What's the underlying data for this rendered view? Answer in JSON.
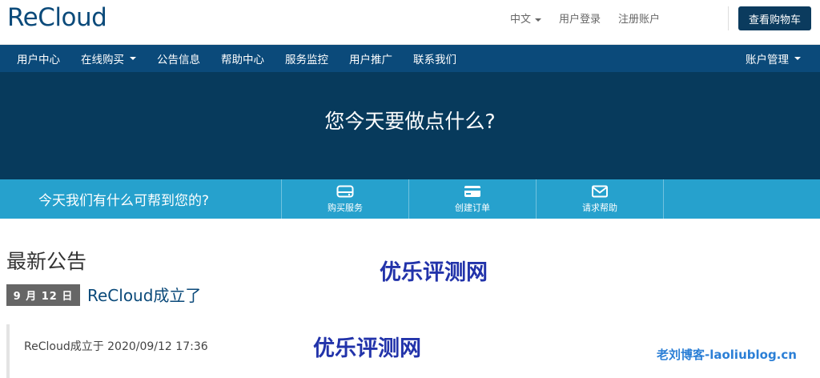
{
  "header": {
    "logo": "ReCloud",
    "language": "中文",
    "login": "用户登录",
    "register": "注册账户",
    "cart": "查看购物车"
  },
  "nav": {
    "items": [
      "用户中心",
      "在线购买",
      "公告信息",
      "帮助中心",
      "服务监控",
      "用户推广",
      "联系我们"
    ],
    "account": "账户管理"
  },
  "hero": {
    "title": "您今天要做点什么?"
  },
  "strip": {
    "prompt": "今天我们有什么可帮到您的?",
    "actions": [
      {
        "label": "购买服务",
        "icon": "server-icon"
      },
      {
        "label": "创建订单",
        "icon": "credit-card-icon"
      },
      {
        "label": "请求帮助",
        "icon": "envelope-icon"
      }
    ]
  },
  "announcements": {
    "heading": "最新公告",
    "date": "9 月 12 日",
    "title": "ReCloud成立了",
    "body": "ReCloud成立于 2020/09/12 17:36"
  },
  "watermarks": {
    "wm1": "优乐评测网",
    "wm2": "优乐评测网",
    "wm3": "老刘博客-laoliublog.cn"
  },
  "colors": {
    "brand": "#0b4a7a",
    "hero": "#073a5c",
    "strip": "#26a1cd",
    "badge": "#666666"
  }
}
